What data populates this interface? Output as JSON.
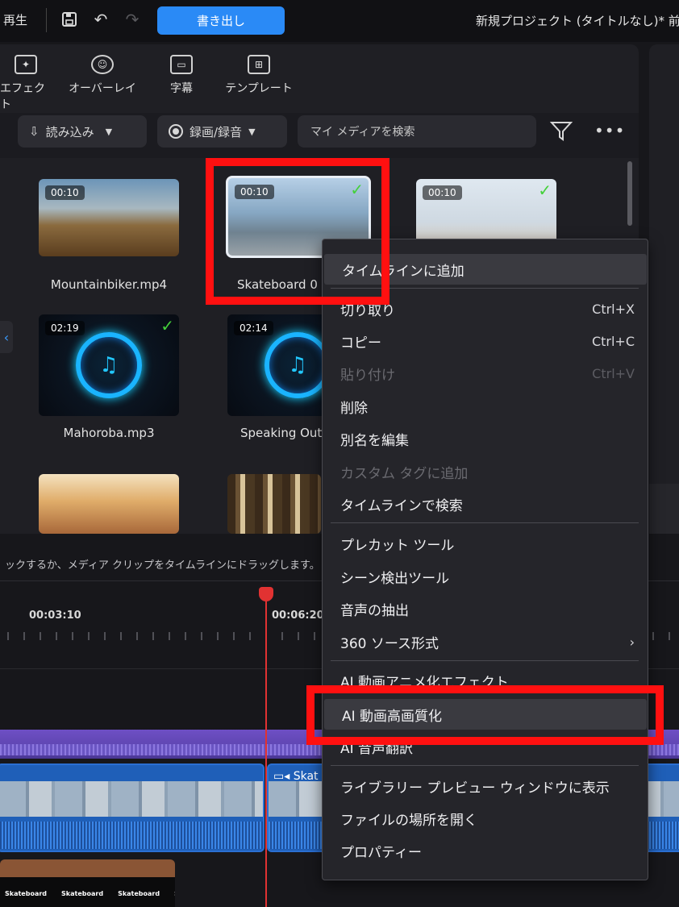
{
  "topbar": {
    "play_label": "再生",
    "save_icon": "save-icon",
    "undo_icon": "undo-icon",
    "redo_icon": "redo-icon",
    "export_label": "書き出し",
    "project_title": "新規プロジェクト (タイトルなし)* 前回("
  },
  "tabs": [
    {
      "label": "エフェクト",
      "icon": "effects-icon"
    },
    {
      "label": "オーバーレイ",
      "icon": "overlay-icon"
    },
    {
      "label": "字幕",
      "icon": "subtitle-icon"
    },
    {
      "label": "テンプレート",
      "icon": "template-icon"
    }
  ],
  "toolbar": {
    "import_label": "読み込み",
    "record_label": "録画/録音",
    "search_placeholder": "マイ メディアを検索",
    "filter_icon": "filter-icon",
    "more_icon": "more-icon"
  },
  "media": [
    {
      "name": "Mountainbiker.mp4",
      "duration": "00:10",
      "used": false
    },
    {
      "name": "Skateboard 0",
      "duration": "00:10",
      "used": true
    },
    {
      "name": "",
      "duration": "00:10",
      "used": true
    },
    {
      "name": "Mahoroba.mp3",
      "duration": "02:19",
      "used": true
    },
    {
      "name": "Speaking Out",
      "duration": "02:14",
      "used": false
    }
  ],
  "hint": "ックするか、メディア クリップをタイムラインにドラッグします。",
  "timeline": {
    "times": [
      "00:03:10",
      "00:06:20"
    ],
    "clip_label": "Skat",
    "title_clip_text": "Skateboard"
  },
  "context_menu": {
    "groups": [
      [
        {
          "label": "タイムラインに追加",
          "shortcut": "",
          "disabled": false,
          "highlighted": true
        }
      ],
      [
        {
          "label": "切り取り",
          "shortcut": "Ctrl+X",
          "disabled": false
        },
        {
          "label": "コピー",
          "shortcut": "Ctrl+C",
          "disabled": false
        },
        {
          "label": "貼り付け",
          "shortcut": "Ctrl+V",
          "disabled": true
        },
        {
          "label": "削除",
          "shortcut": "",
          "disabled": false
        },
        {
          "label": "別名を編集",
          "shortcut": "",
          "disabled": false
        },
        {
          "label": "カスタム タグに追加",
          "shortcut": "",
          "disabled": true
        },
        {
          "label": "タイムラインで検索",
          "shortcut": "",
          "disabled": false
        }
      ],
      [
        {
          "label": "プレカット ツール",
          "shortcut": "",
          "disabled": false
        },
        {
          "label": "シーン検出ツール",
          "shortcut": "",
          "disabled": false
        },
        {
          "label": "音声の抽出",
          "shortcut": "",
          "disabled": false
        },
        {
          "label": "360 ソース形式",
          "shortcut": "›",
          "disabled": false
        }
      ],
      [
        {
          "label": "AI 動画アニメ化エフェクト",
          "shortcut": "",
          "disabled": false
        },
        {
          "label": "AI 動画高画質化",
          "shortcut": "",
          "disabled": false,
          "highlighted": true
        },
        {
          "label": "AI 音声翻訳",
          "shortcut": "",
          "disabled": false
        }
      ],
      [
        {
          "label": "ライブラリー プレビュー ウィンドウに表示",
          "shortcut": "",
          "disabled": false
        },
        {
          "label": "ファイルの場所を開く",
          "shortcut": "",
          "disabled": false
        },
        {
          "label": "プロパティー",
          "shortcut": "",
          "disabled": false
        }
      ]
    ]
  },
  "colors": {
    "accent": "#2a8af6",
    "highlight_box": "#ff1010",
    "check": "#44d13a",
    "playhead": "#e13232"
  }
}
